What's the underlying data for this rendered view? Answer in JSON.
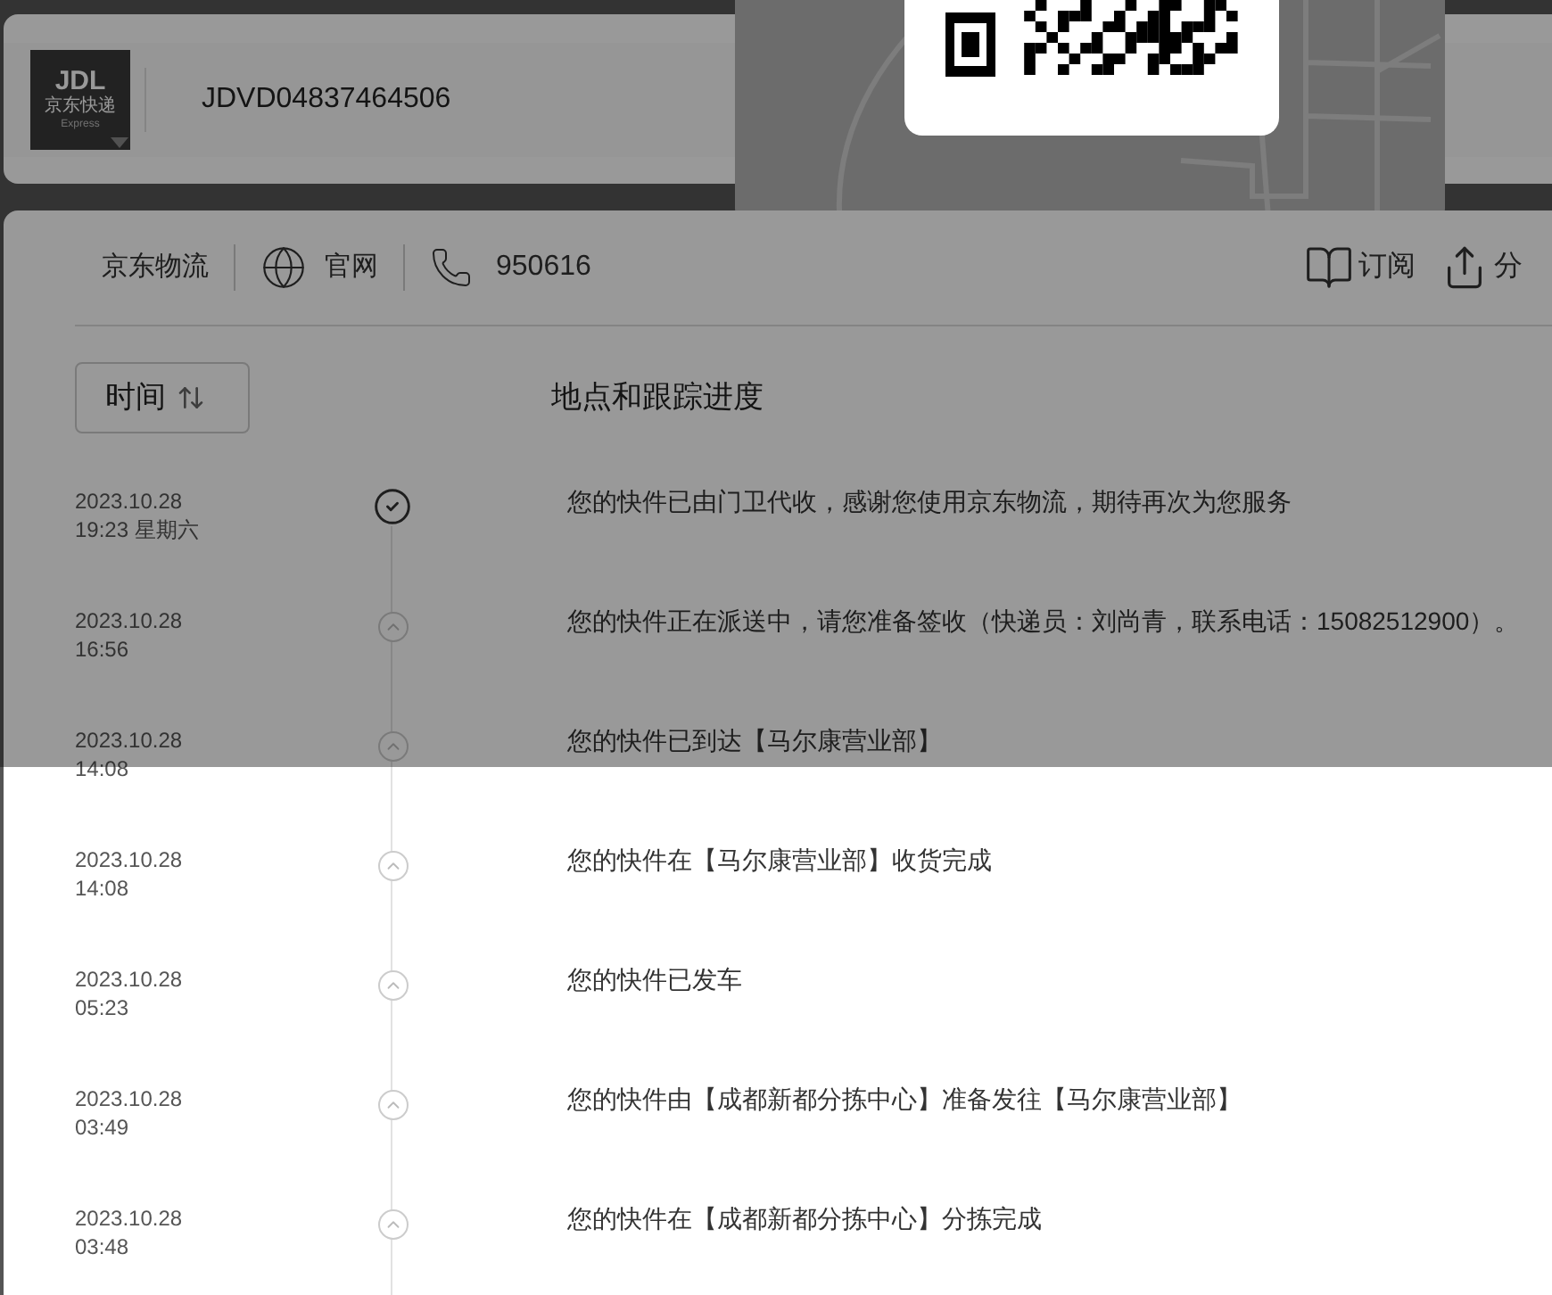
{
  "logo": {
    "mark": "JDL",
    "name": "京东快递",
    "sub": "Express"
  },
  "tracking_number": "JDVD04837464506",
  "carrier_bar": {
    "carrier": "京东物流",
    "website": "官网",
    "phone": "950616",
    "subscribe": "订阅",
    "share": "分"
  },
  "sort_button": {
    "label": "时间"
  },
  "progress_heading": "地点和跟踪进度",
  "events": [
    {
      "date": "2023.10.28",
      "time": "19:23 星期六",
      "text": "您的快件已由门卫代收，感谢您使用京东物流，期待再次为您服务",
      "current": true
    },
    {
      "date": "2023.10.28",
      "time": "16:56",
      "text": "您的快件正在派送中，请您准备签收（快递员：刘尚青，联系电话：15082512900）。",
      "current": false
    },
    {
      "date": "2023.10.28",
      "time": "14:08",
      "text": "您的快件已到达【马尔康营业部】",
      "current": false
    },
    {
      "date": "2023.10.28",
      "time": "14:08",
      "text": "您的快件在【马尔康营业部】收货完成",
      "current": false
    },
    {
      "date": "2023.10.28",
      "time": "05:23",
      "text": "您的快件已发车",
      "current": false
    },
    {
      "date": "2023.10.28",
      "time": "03:49",
      "text": "您的快件由【成都新都分拣中心】准备发往【马尔康营业部】",
      "current": false
    },
    {
      "date": "2023.10.28",
      "time": "03:48",
      "text": "您的快件在【成都新都分拣中心】分拣完成",
      "current": false
    }
  ]
}
